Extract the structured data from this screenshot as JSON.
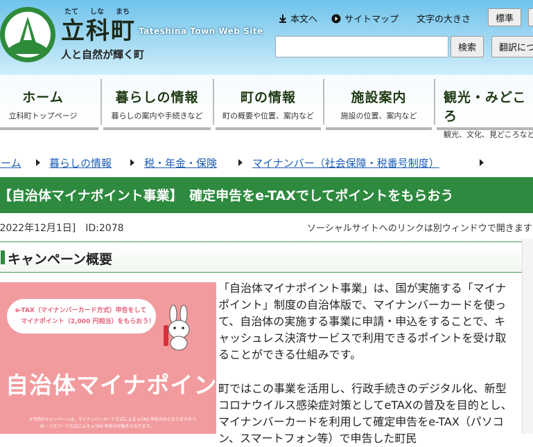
{
  "header": {
    "site_title": "立科町",
    "ruby": [
      "たて",
      "しな",
      "まち"
    ],
    "site_title_en": "Tateshina Town Web Site",
    "tagline": "人と自然が輝く町",
    "links": {
      "skip_to_content": "本文へ",
      "sitemap": "サイトマップ",
      "text_size": "文字の大きさ"
    },
    "text_size_button": "標準",
    "search_button": "検索",
    "translate_button": "翻訳につ",
    "search_placeholder": ""
  },
  "nav": {
    "items": [
      {
        "title": "ホーム",
        "sub": "立科町トップページ"
      },
      {
        "title": "暮らしの情報",
        "sub": "暮らしの案内や手続きなど"
      },
      {
        "title": "町の情報",
        "sub": "町の概要や位置、案内など"
      },
      {
        "title": "施設案内",
        "sub": "施設の位置、案内など"
      },
      {
        "title": "観光・みどころ",
        "sub": "観光、文化、見どころなど"
      }
    ]
  },
  "breadcrumb": [
    "ホーム",
    "暮らしの情報",
    "税・年金・保険",
    "マイナンバー（社会保障・税番号制度）"
  ],
  "page": {
    "title": "【自治体マイナポイント事業】　確定申告をe-TAXでしてポイントをもらおう",
    "date_id": "[2022年12月1日]　ID:2078",
    "social_note": "ソーシャルサイトへのリンクは別ウィンドウで開きます"
  },
  "section": {
    "heading": "キャンペーン概要"
  },
  "banner": {
    "line1": "e-TAX（マイナンバーカード方式）申告をして",
    "line2": "マイナポイント（2,000 円相当）をもらおう！",
    "title": "自治体マイナポイント",
    "note1": "※今回のキャンペーンは、マイナンバーカード方式による e-TAX 申告のみとなりますので、",
    "note2": "ID・パスワード方式による e-TAX 申告は対象外となります。"
  },
  "content": {
    "paragraph1": "「自治体マイナポイント事業」は、国が実施する「マイナポイント」制度の自治体版で、マイナンバーカードを使って、自治体の実施する事業に申請・申込をすることで、キャッシュレス決済サービスで利用できるポイントを受け取ることができる仕組みです。",
    "paragraph2": "町ではこの事業を活用し、行政手続きのデジタル化、新型コロナウイルス感染症対策としてeTAXの普及を目的とし、マイナンバーカードを利用して確定申告をe-TAX（パソコン、スマートフォン等）で申告した町民"
  },
  "colors": {
    "accent_green": "#2d8a3e",
    "link_blue": "#1b5db3",
    "banner_pink": "#f29b9e"
  }
}
